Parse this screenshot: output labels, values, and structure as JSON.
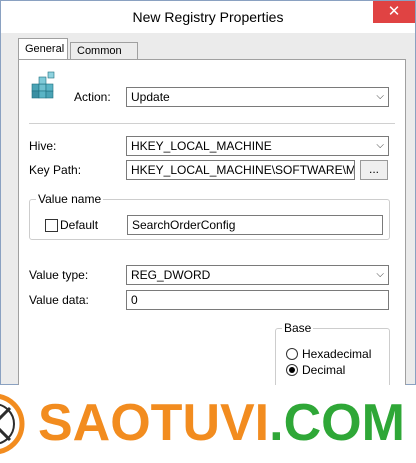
{
  "window": {
    "title": "New Registry Properties",
    "close_glyph": "✕"
  },
  "tabs": [
    {
      "label": "General"
    },
    {
      "label": "Common"
    }
  ],
  "general": {
    "action_label": "Action:",
    "action_value": "Update",
    "hive_label": "Hive:",
    "hive_value": "HKEY_LOCAL_MACHINE",
    "keypath_label": "Key Path:",
    "keypath_value": "HKEY_LOCAL_MACHINE\\SOFTWARE\\Microsoft\\",
    "browse_label": "...",
    "value_name_group": "Value name",
    "default_label": "Default",
    "default_checked": false,
    "value_name": "SearchOrderConfig",
    "value_type_label": "Value type:",
    "value_type": "REG_DWORD",
    "value_data_label": "Value data:",
    "value_data": "0",
    "base_group": "Base",
    "base_options": [
      {
        "label": "Hexadecimal",
        "checked": false
      },
      {
        "label": "Decimal",
        "checked": true
      }
    ]
  },
  "watermark": {
    "text_main": "SAOTUVI",
    "text_com": ".COM",
    "brand_orange": "#f28c1f",
    "brand_green": "#2fa737"
  },
  "icons": {
    "registry": "registry-cubes-icon",
    "dropdown": "chevron-down-icon"
  }
}
